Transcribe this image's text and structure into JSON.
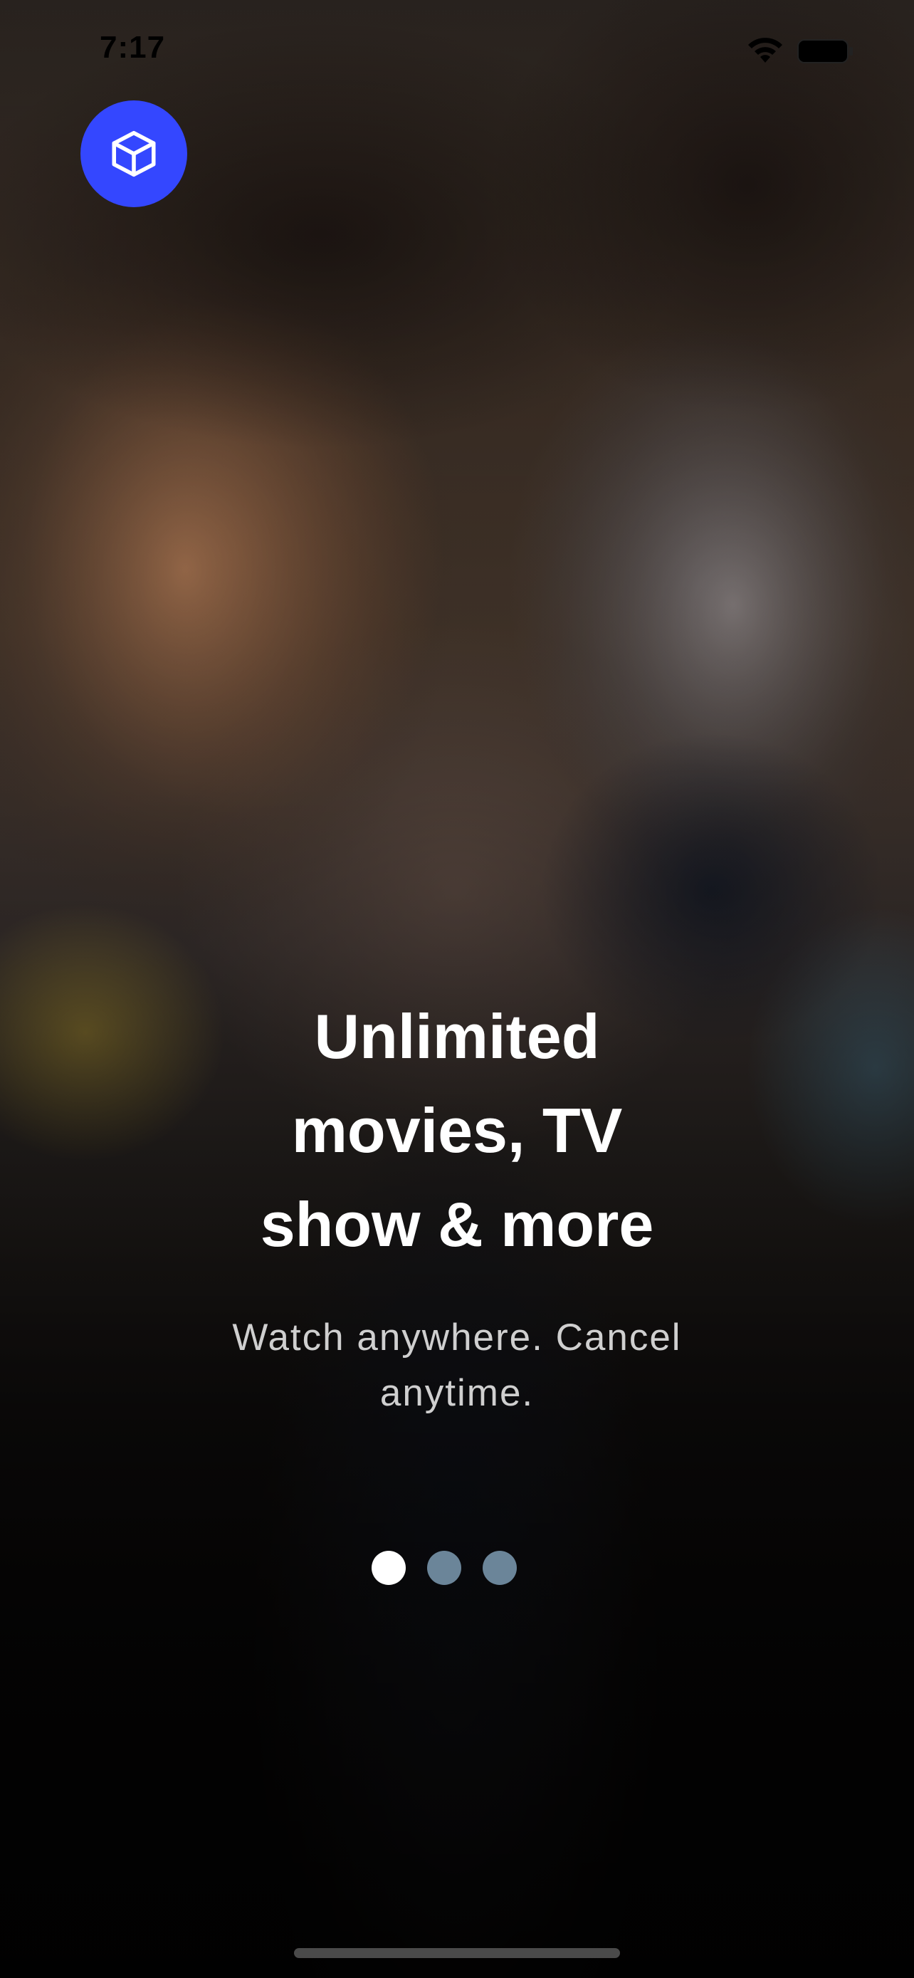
{
  "status_bar": {
    "time": "7:17",
    "wifi_icon": "wifi-icon",
    "battery_icon": "battery-icon"
  },
  "logo": {
    "icon": "cube-icon",
    "color": "#3447ff"
  },
  "onboarding": {
    "headline_lines": [
      "Unlimited",
      "movies, TV",
      "show & more"
    ],
    "subtitle": "Watch anywhere. Cancel anytime.",
    "pages_total": 3,
    "current_page": 1
  },
  "colors": {
    "dot_active": "#ffffff",
    "dot_inactive": "#6b8599"
  }
}
